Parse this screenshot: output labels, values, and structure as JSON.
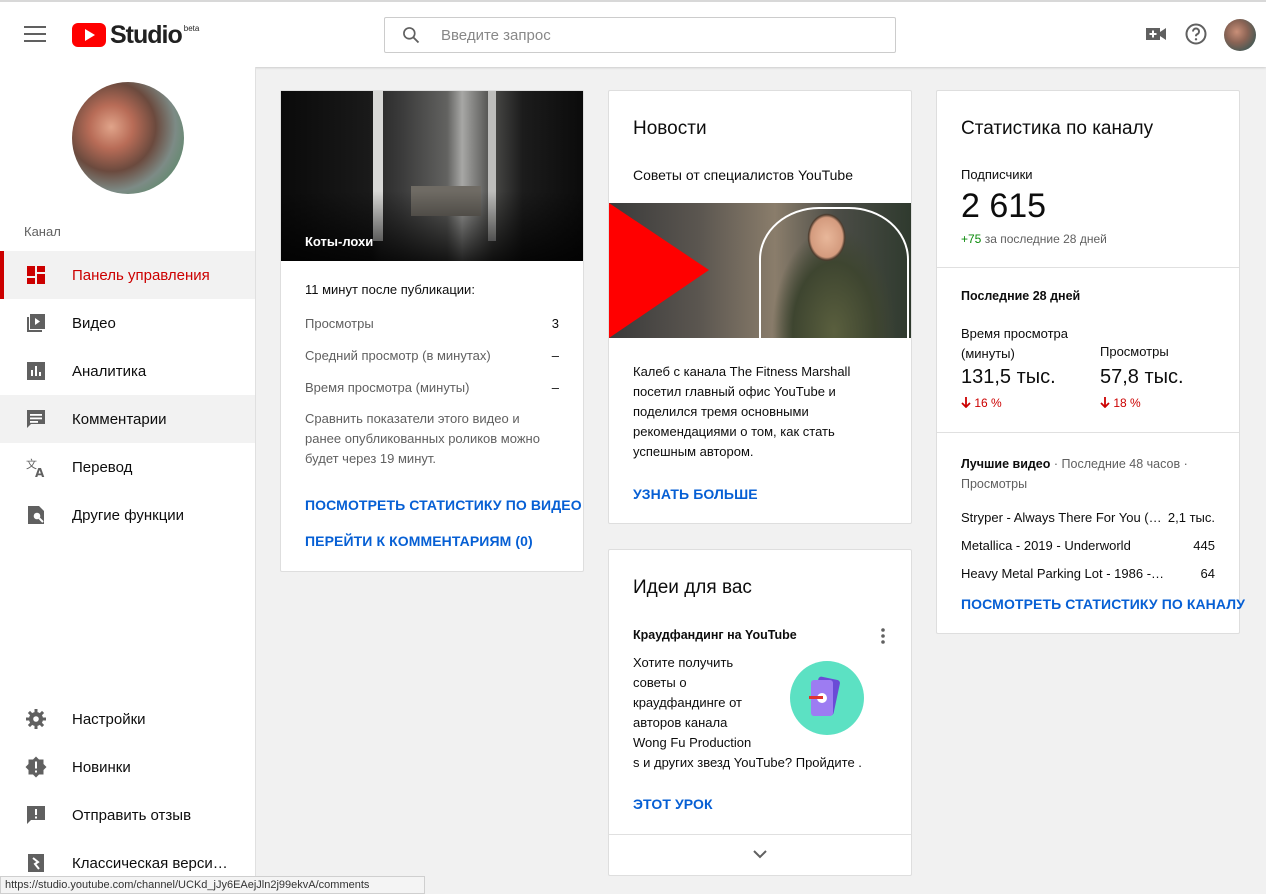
{
  "header": {
    "logo_text": "Studio",
    "logo_badge": "beta",
    "search_placeholder": "Введите запрос"
  },
  "sidebar": {
    "section_label": "Канал",
    "items": [
      {
        "label": "Панель управления",
        "icon": "dashboard-icon"
      },
      {
        "label": "Видео",
        "icon": "video-icon"
      },
      {
        "label": "Аналитика",
        "icon": "analytics-icon"
      },
      {
        "label": "Комментарии",
        "icon": "comments-icon"
      },
      {
        "label": "Перевод",
        "icon": "translate-icon"
      },
      {
        "label": "Другие функции",
        "icon": "more-features-icon"
      }
    ],
    "bottom_items": [
      {
        "label": "Настройки",
        "icon": "settings-icon"
      },
      {
        "label": "Новинки",
        "icon": "whats-new-icon"
      },
      {
        "label": "Отправить отзыв",
        "icon": "feedback-icon"
      },
      {
        "label": "Классическая верси…",
        "icon": "classic-icon"
      }
    ]
  },
  "latest_video": {
    "thumb_title": "Коты-лохи",
    "subtitle": "11 минут после публикации:",
    "rows": [
      {
        "label": "Просмотры",
        "value": "3"
      },
      {
        "label": "Средний просмотр (в минутах)",
        "value": "–"
      },
      {
        "label": "Время просмотра (минуты)",
        "value": "–"
      }
    ],
    "note_lines": [
      "Сравнить показатели этого видео и",
      "ранее опубликованных роликов можно",
      "будет через 19 минут."
    ],
    "link_stats": "ПОСМОТРЕТЬ СТАТИСТИКУ ПО ВИДЕО",
    "link_comments": "ПЕРЕЙТИ К КОММЕНТАРИЯМ (0)"
  },
  "news": {
    "title": "Новости",
    "subtitle": "Советы от специалистов YouTube",
    "body_lines": [
      "Калеб с канала The Fitness Marshall",
      "посетил главный офис YouTube и",
      "поделился тремя основными",
      "рекомендациями о том, как стать",
      "успешным автором."
    ],
    "link": "УЗНАТЬ БОЛЬШЕ"
  },
  "ideas": {
    "title": "Идеи для вас",
    "subtitle": "Краудфандинг на YouTube",
    "body_lines": [
      "Хотите получить",
      "советы о",
      "краудфандинге от",
      "авторов канала",
      "Wong Fu Production",
      "s и других звезд YouTube? Пройдите ."
    ],
    "link": "ЭТОТ УРОК"
  },
  "channel_stats": {
    "title": "Статистика по каналу",
    "subscribers_label": "Подписчики",
    "subscribers_value": "2 615",
    "subscribers_delta": "+75",
    "subscribers_delta_note": "за последние 28 дней",
    "period_label": "Последние 28 дней",
    "watch_time_label_1": "Время просмотра",
    "watch_time_label_2": "(минуты)",
    "watch_time_value": "131,5 тыс.",
    "watch_time_change": "16 %",
    "views_label": "Просмотры",
    "views_value": "57,8 тыс.",
    "views_change": "18 %",
    "top_label": "Лучшие видео",
    "top_period": "· Последние 48 часов ·",
    "top_metric": "Просмотры",
    "top_videos": [
      {
        "title": "Stryper - Always There For You (…",
        "value": "2,1 тыс."
      },
      {
        "title": "Metallica - 2019 - Underworld",
        "value": "445"
      },
      {
        "title": "Heavy Metal Parking Lot - 1986 -…",
        "value": "64"
      }
    ],
    "link": "ПОСМОТРЕТЬ СТАТИСТИКУ ПО КАНАЛУ"
  },
  "statusbar": {
    "url": "https://studio.youtube.com/channel/UCKd_jJy6EAejJln2j99ekvA/comments"
  },
  "colors": {
    "accent_red": "#cc0000",
    "link_blue": "#065fd4",
    "positive_green": "#0a8a0a",
    "negative_red": "#cc0000"
  }
}
